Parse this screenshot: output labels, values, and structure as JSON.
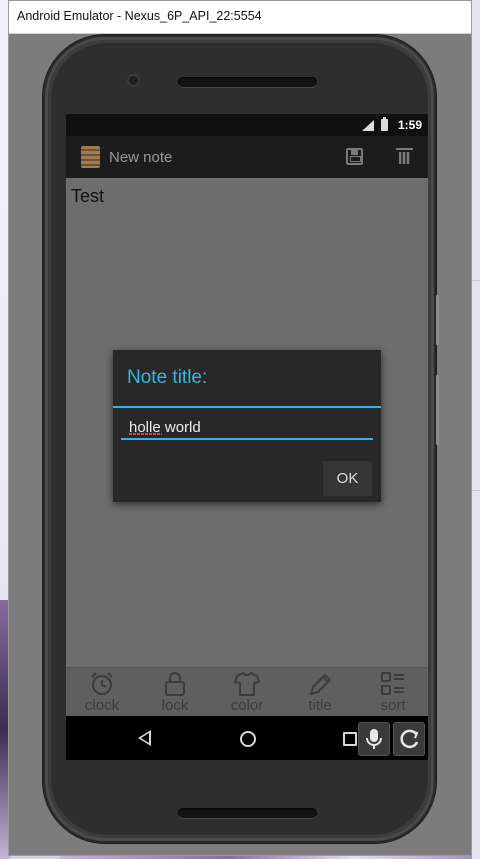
{
  "window": {
    "title": "Android Emulator - Nexus_6P_API_22:5554"
  },
  "statusbar": {
    "time": "1:59"
  },
  "actionbar": {
    "title": "New note",
    "icons": [
      "notepad-icon",
      "save-icon",
      "delete-icon"
    ]
  },
  "note": {
    "text": "Test"
  },
  "dialog": {
    "title": "Note title:",
    "input_value": "holle world",
    "ok_label": "OK",
    "accent_color": "#33b5e5"
  },
  "toolbar": {
    "items": [
      {
        "label": "clock",
        "icon": "alarm-clock-icon"
      },
      {
        "label": "lock",
        "icon": "lock-icon"
      },
      {
        "label": "color",
        "icon": "shirt-icon"
      },
      {
        "label": "title",
        "icon": "pencil-icon"
      },
      {
        "label": "sort",
        "icon": "list-icon"
      }
    ]
  },
  "navbar": {
    "icons": [
      "back-icon",
      "home-icon",
      "recents-icon",
      "microphone-icon",
      "rotate-icon"
    ]
  }
}
